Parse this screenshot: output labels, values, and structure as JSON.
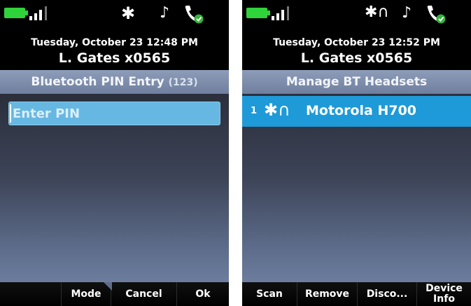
{
  "left_screen": {
    "status": {
      "bluetooth_icon": "bluetooth-icon",
      "ringer_icon": "music-note-icon",
      "phone_icon": "phone-icon"
    },
    "header": {
      "datetime": "Tuesday, October 23 12:48 PM",
      "user": "L. Gates x0565"
    },
    "title": "Bluetooth PIN Entry",
    "title_mode": "(123)",
    "pin_placeholder": "Enter PIN",
    "softkeys": [
      "",
      "Mode",
      "Cancel",
      "Ok"
    ]
  },
  "right_screen": {
    "status": {
      "bluetooth_headset_icon": "bluetooth-headset-icon",
      "ringer_icon": "music-note-icon",
      "phone_icon": "phone-icon"
    },
    "header": {
      "datetime": "Tuesday, October 23 12:52 PM",
      "user": "L. Gates x0565"
    },
    "title": "Manage BT Headsets",
    "list": [
      {
        "index": "1",
        "name": "Motorola H700"
      }
    ],
    "softkeys": [
      "Scan",
      "Remove",
      "Disco...",
      "Device",
      "Info"
    ]
  },
  "colors": {
    "accent_blue": "#1e9ad8",
    "input_blue": "#66b8e2",
    "battery_green": "#2fd33a",
    "title_bar": "#7d8cab"
  }
}
